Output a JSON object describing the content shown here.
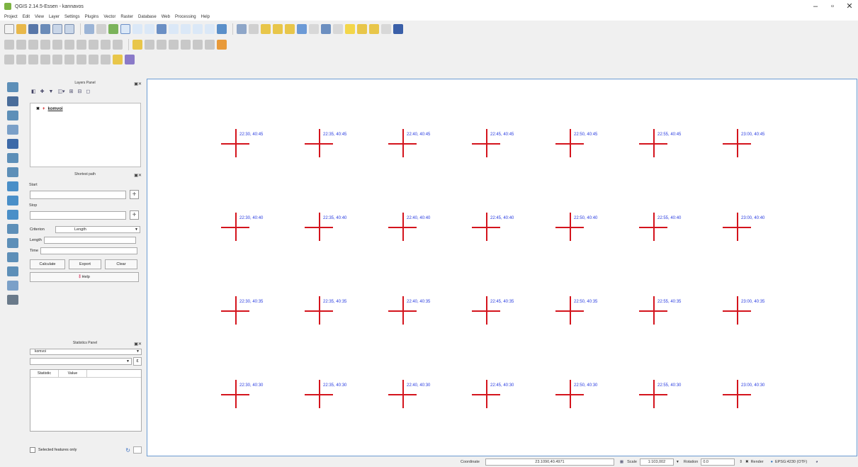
{
  "window": {
    "title": "QGIS 2.14.5-Essen - kannavos",
    "minimize": "–",
    "maximize": "▫",
    "close": "✕"
  },
  "menu": [
    "Project",
    "Edit",
    "View",
    "Layer",
    "Settings",
    "Plugins",
    "Vector",
    "Raster",
    "Database",
    "Web",
    "Processing",
    "Help"
  ],
  "layers_panel": {
    "title": "Layers Panel",
    "layer_name": "komvoi"
  },
  "shortest_path": {
    "title": "Shortest path",
    "start_label": "Start",
    "stop_label": "Stop",
    "criterion_label": "Criterion",
    "criterion_value": "Length",
    "length_label": "Length",
    "time_label": "Time",
    "calculate": "Calculate",
    "export": "Export",
    "clear": "Clear",
    "help": "Help"
  },
  "stats_panel": {
    "title": "Statistics Panel",
    "layer": "komvoi",
    "col_statistic": "Statistic",
    "col_value": "Value",
    "selected_only": "Selected features only"
  },
  "grid": {
    "rows": [
      [
        "22:30, 40:45",
        "22:35, 40:45",
        "22:40, 40:45",
        "22:45, 40:45",
        "22:50, 40:45",
        "22:55, 40:45",
        "23:00, 40:45"
      ],
      [
        "22:30, 40:40",
        "22:35, 40:40",
        "22:40, 40:40",
        "22:45, 40:40",
        "22:50, 40:40",
        "22:55, 40:40",
        "23:00, 40:40"
      ],
      [
        "22:30, 40:35",
        "22:35, 40:35",
        "22:40, 40:35",
        "22:45, 40:35",
        "22:50, 40:35",
        "22:55, 40:35",
        "23:00, 40:35"
      ],
      [
        "22:30, 40:30",
        "22:35, 40:30",
        "22:40, 40:30",
        "22:45, 40:30",
        "22:50, 40:30",
        "22:55, 40:30",
        "23:00, 40:30"
      ]
    ],
    "color": "#d4141d",
    "label_color": "#2a3de0"
  },
  "status": {
    "coordinate_label": "Coordinate",
    "coordinate_value": "23.1090,40.4971",
    "scale_label": "Scale",
    "scale_value": "1:103,002",
    "rotation_label": "Rotation",
    "rotation_value": "0.0",
    "render_label": "Render",
    "crs": "EPSG:4230 (OTF)"
  }
}
